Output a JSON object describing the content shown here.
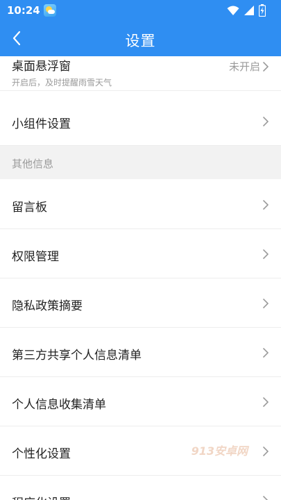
{
  "status_bar": {
    "time": "10:24"
  },
  "header": {
    "title": "设置"
  },
  "rows": {
    "float_window": {
      "title": "桌面悬浮窗",
      "subtitle": "开启后，及时提醒雨雪天气",
      "value": "未开启"
    },
    "widget_settings": {
      "title": "小组件设置"
    }
  },
  "section_other": {
    "title": "其他信息",
    "items": [
      {
        "label": "留言板"
      },
      {
        "label": "权限管理"
      },
      {
        "label": "隐私政策摘要"
      },
      {
        "label": "第三方共享个人信息清单"
      },
      {
        "label": "个人信息收集清单"
      },
      {
        "label": "个性化设置"
      },
      {
        "label": "程序化设置"
      }
    ]
  },
  "watermark": "913安卓网",
  "colors": {
    "primary": "#2f8ef2",
    "divider": "#ededed",
    "section_bg": "#f2f2f2"
  }
}
